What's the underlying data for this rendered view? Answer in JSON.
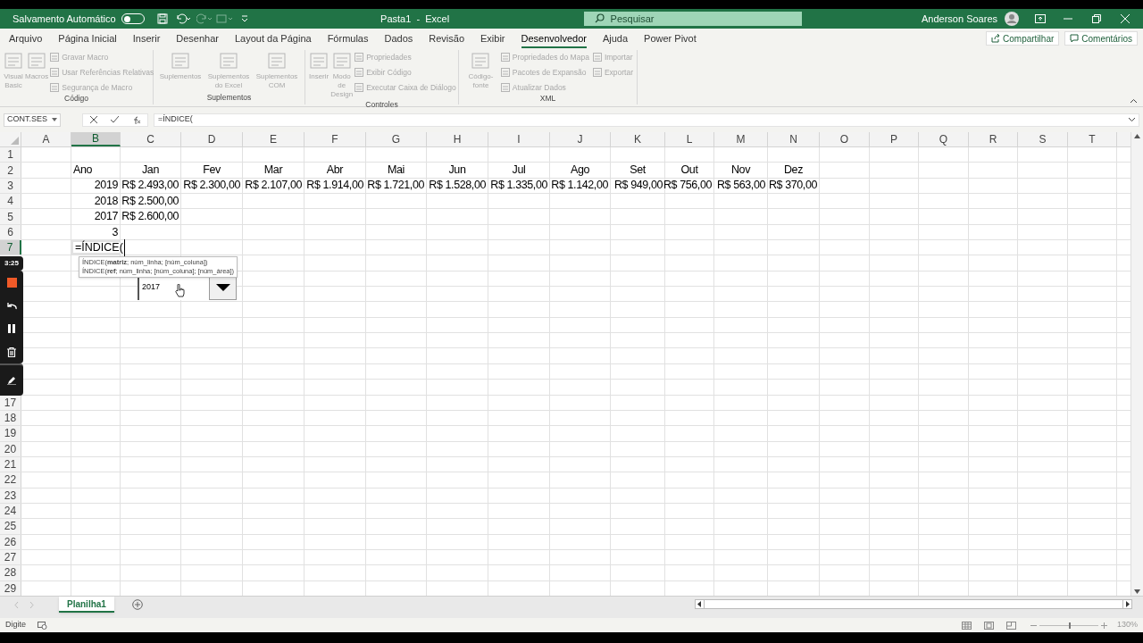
{
  "title_bar": {
    "autosave_label": "Salvamento Automático",
    "autosave_on": false,
    "title": "Pasta1  -  Excel",
    "search": {
      "placeholder": "Pesquisar"
    },
    "user": "Anderson Soares"
  },
  "tabs": [
    {
      "label": "Arquivo",
      "selected": false
    },
    {
      "label": "Página Inicial",
      "selected": false
    },
    {
      "label": "Inserir",
      "selected": false
    },
    {
      "label": "Desenhar",
      "selected": false
    },
    {
      "label": "Layout da Página",
      "selected": false
    },
    {
      "label": "Fórmulas",
      "selected": false
    },
    {
      "label": "Dados",
      "selected": false
    },
    {
      "label": "Revisão",
      "selected": false
    },
    {
      "label": "Exibir",
      "selected": false
    },
    {
      "label": "Desenvolvedor",
      "selected": true
    },
    {
      "label": "Ajuda",
      "selected": false
    },
    {
      "label": "Power Pivot",
      "selected": false
    }
  ],
  "ribbon_actions": [
    "Compartilhar",
    "Comentários"
  ],
  "ribbon_groups": [
    {
      "label": "Código",
      "large": [
        {
          "label": "Visual Basic",
          "disabled": true
        },
        {
          "label": "Macros",
          "disabled": true
        }
      ],
      "small": [
        {
          "label": "Gravar Macro",
          "disabled": true
        },
        {
          "label": "Usar Referências Relativas",
          "disabled": true
        },
        {
          "label": "Segurança de Macro",
          "disabled": true
        }
      ]
    },
    {
      "label": "Suplementos",
      "large": [
        {
          "label": "Suplementos",
          "disabled": true
        },
        {
          "label": "Suplementos do Excel",
          "disabled": true
        },
        {
          "label": "Suplementos COM",
          "disabled": true
        }
      ]
    },
    {
      "label": "Controles",
      "large": [
        {
          "label": "Inserir",
          "disabled": true
        },
        {
          "label": "Modo de Design",
          "disabled": true
        }
      ],
      "small": [
        {
          "label": "Propriedades",
          "disabled": true
        },
        {
          "label": "Exibir Código",
          "disabled": true
        },
        {
          "label": "Executar Caixa de Diálogo",
          "disabled": true
        }
      ]
    },
    {
      "label": "XML",
      "large": [
        {
          "label": "Código-fonte",
          "disabled": true
        }
      ],
      "small": [
        {
          "label": "Propriedades do Mapa",
          "disabled": true
        },
        {
          "label": "Pacotes de Expansão",
          "disabled": true
        },
        {
          "label": "Atualizar Dados",
          "disabled": true
        },
        {
          "label": "Importar",
          "disabled": true
        },
        {
          "label": "Exportar",
          "disabled": true
        }
      ]
    }
  ],
  "formula_bar": {
    "name_box": "CONT.SES",
    "formula": "=ÍNDICE("
  },
  "columns": [
    {
      "letter": "A",
      "selected": false
    },
    {
      "letter": "B",
      "selected": true
    },
    {
      "letter": "C",
      "selected": false
    },
    {
      "letter": "D",
      "selected": false
    },
    {
      "letter": "E",
      "selected": false
    },
    {
      "letter": "F",
      "selected": false
    },
    {
      "letter": "G",
      "selected": false
    },
    {
      "letter": "H",
      "selected": false
    },
    {
      "letter": "I",
      "selected": false
    },
    {
      "letter": "J",
      "selected": false
    },
    {
      "letter": "K",
      "selected": false
    },
    {
      "letter": "L",
      "selected": false
    },
    {
      "letter": "M",
      "selected": false
    },
    {
      "letter": "N",
      "selected": false
    },
    {
      "letter": "O",
      "selected": false
    },
    {
      "letter": "P",
      "selected": false
    },
    {
      "letter": "Q",
      "selected": false
    },
    {
      "letter": "R",
      "selected": false
    },
    {
      "letter": "S",
      "selected": false
    },
    {
      "letter": "T",
      "selected": false
    }
  ],
  "rows": [
    {
      "number": "1",
      "selected": false,
      "cells": []
    },
    {
      "number": "2",
      "selected": false,
      "cells": [
        null,
        {
          "text": "Ano",
          "kind": "label"
        },
        {
          "text": "Jan",
          "kind": "header"
        },
        {
          "text": "Fev",
          "kind": "header"
        },
        {
          "text": "Mar",
          "kind": "header"
        },
        {
          "text": "Abr",
          "kind": "header"
        },
        {
          "text": "Mai",
          "kind": "header"
        },
        {
          "text": "Jun",
          "kind": "header"
        },
        {
          "text": "Jul",
          "kind": "header"
        },
        {
          "text": "Ago",
          "kind": "header"
        },
        {
          "text": "Set",
          "kind": "header"
        },
        {
          "text": "Out",
          "kind": "header"
        },
        {
          "text": "Nov",
          "kind": "header"
        },
        {
          "text": "Dez",
          "kind": "header"
        }
      ]
    },
    {
      "number": "3",
      "selected": false,
      "cells": [
        null,
        {
          "text": "2019",
          "kind": "number"
        },
        {
          "text": "R$ 2.493,00",
          "kind": "number"
        },
        {
          "text": "R$ 2.300,00",
          "kind": "number"
        },
        {
          "text": "R$ 2.107,00",
          "kind": "number"
        },
        {
          "text": "R$ 1.914,00",
          "kind": "number"
        },
        {
          "text": "R$ 1.721,00",
          "kind": "number"
        },
        {
          "text": "R$ 1.528,00",
          "kind": "number"
        },
        {
          "text": "R$ 1.335,00",
          "kind": "number"
        },
        {
          "text": "R$ 1.142,00",
          "kind": "number"
        },
        {
          "text": "R$ 949,00",
          "kind": "number"
        },
        {
          "text": "R$ 756,00",
          "kind": "number"
        },
        {
          "text": "R$ 563,00",
          "kind": "number"
        },
        {
          "text": "R$ 370,00",
          "kind": "number"
        }
      ]
    },
    {
      "number": "4",
      "selected": false,
      "cells": [
        null,
        {
          "text": "2018",
          "kind": "number"
        },
        {
          "text": "R$ 2.500,00",
          "kind": "number"
        }
      ]
    },
    {
      "number": "5",
      "selected": false,
      "cells": [
        null,
        {
          "text": "2017",
          "kind": "number"
        },
        {
          "text": "R$ 2.600,00",
          "kind": "number"
        }
      ]
    },
    {
      "number": "6",
      "selected": false,
      "cells": [
        null,
        {
          "text": "3",
          "kind": "number"
        }
      ]
    },
    {
      "number": "7",
      "selected": true,
      "cells": [
        null,
        {
          "text": "=ÍNDICE(",
          "kind": "editing"
        }
      ]
    },
    {
      "cells": []
    },
    {
      "cells": []
    },
    {
      "cells": []
    },
    {
      "cells": []
    },
    {
      "cells": []
    },
    {
      "cells": []
    },
    {
      "cells": []
    },
    {
      "cells": []
    },
    {
      "cells": []
    },
    {
      "number": "17",
      "selected": false,
      "cells": []
    },
    {
      "number": "18",
      "selected": false,
      "cells": []
    },
    {
      "number": "19",
      "selected": false,
      "cells": []
    },
    {
      "number": "20",
      "selected": false,
      "cells": []
    },
    {
      "number": "21",
      "selected": false,
      "cells": []
    },
    {
      "number": "22",
      "selected": false,
      "cells": []
    },
    {
      "number": "23",
      "selected": false,
      "cells": []
    },
    {
      "number": "24",
      "selected": false,
      "cells": []
    },
    {
      "number": "25",
      "selected": false,
      "cells": []
    },
    {
      "number": "26",
      "selected": false,
      "cells": []
    },
    {
      "number": "27",
      "selected": false,
      "cells": []
    },
    {
      "number": "28",
      "selected": false,
      "cells": []
    },
    {
      "number": "29",
      "selected": false,
      "cells": []
    }
  ],
  "tooltip": {
    "lines": [
      "ÍNDICE(**matriz**; núm_linha; [núm_coluna])",
      "ÍNDICE(**ref**; núm_linha; [núm_coluna]; [núm_área])"
    ]
  },
  "combo_box": {
    "value": "2017"
  },
  "recorder": {
    "time": "3:25"
  },
  "sheets": [
    {
      "label": "Planilha1",
      "selected": true
    }
  ],
  "status_bar": {
    "mode": "Digite",
    "zoom": "130%",
    "zoom_slider": {
      "level": 0.5
    }
  }
}
